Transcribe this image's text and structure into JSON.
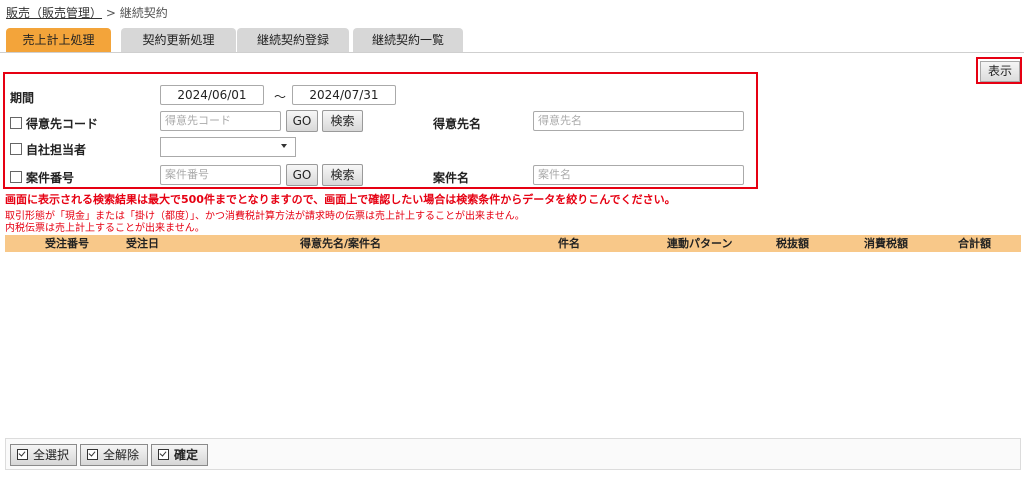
{
  "breadcrumb": {
    "home": "販売（販売管理）",
    "sep": ">",
    "current": "継続契約"
  },
  "tabs": [
    {
      "label": "売上計上処理",
      "active": true
    },
    {
      "label": "契約更新処理",
      "active": false
    },
    {
      "label": "継続契約登録",
      "active": false
    },
    {
      "label": "継続契約一覧",
      "active": false
    }
  ],
  "show_button": "表示",
  "search": {
    "period_label": "期間",
    "date_from": "2024/06/01",
    "tilde": "～",
    "date_to": "2024/07/31",
    "customer_code_label": "得意先コード",
    "customer_code_placeholder": "得意先コード",
    "go_label": "GO",
    "search_label": "検索",
    "customer_name_label": "得意先名",
    "customer_name_placeholder": "得意先名",
    "staff_label": "自社担当者",
    "staff_value": "",
    "project_no_label": "案件番号",
    "project_no_placeholder": "案件番号",
    "project_name_label": "案件名",
    "project_name_placeholder": "案件名"
  },
  "notices": {
    "line1": "画面に表示される検索結果は最大で500件までとなりますので、画面上で確認したい場合は検索条件からデータを絞りこんでください。",
    "line2": "取引形態が「現金」または「掛け（都度）」、かつ消費税計算方法が請求時の伝票は売上計上することが出来ません。",
    "line3": "内税伝票は売上計上することが出来ません。"
  },
  "table": {
    "columns": [
      "受注番号",
      "受注日",
      "得意先名/案件名",
      "件名",
      "連動パターン",
      "税抜額",
      "消費税額",
      "合計額"
    ],
    "rows": []
  },
  "footer": {
    "select_all": "全選択",
    "deselect_all": "全解除",
    "confirm": "確定"
  },
  "colors": {
    "active_tab": "#f3a43a",
    "highlight_border": "#e60012",
    "table_header": "#f8c889",
    "notice_text": "#e60012"
  }
}
